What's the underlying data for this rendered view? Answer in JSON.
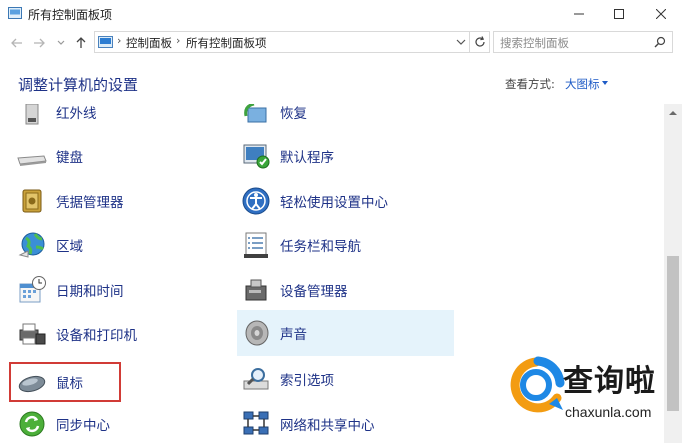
{
  "window": {
    "title": "所有控制面板项"
  },
  "address": {
    "crumbs": [
      "控制面板",
      "所有控制面板项"
    ],
    "search_placeholder": "搜索控制面板"
  },
  "header": {
    "title": "调整计算机的设置",
    "view_by_label": "查看方式:",
    "view_by_value": "大图标"
  },
  "items": {
    "left": [
      "红外线",
      "键盘",
      "凭据管理器",
      "区域",
      "日期和时间",
      "设备和打印机",
      "鼠标",
      "同步中心"
    ],
    "right": [
      "恢复",
      "默认程序",
      "轻松使用设置中心",
      "任务栏和导航",
      "设备管理器",
      "声音",
      "索引选项",
      "网络和共享中心"
    ]
  },
  "highlighted_item": "声音",
  "boxed_item": "鼠标",
  "watermark": {
    "name": "查询啦",
    "url": "chaxunla.com"
  },
  "colors": {
    "link_text": "#1e3287",
    "highlight": "#e5f3fb",
    "red_box": "#d13b36",
    "watermark_orange": "#f39c12",
    "watermark_blue": "#1e88e5"
  }
}
